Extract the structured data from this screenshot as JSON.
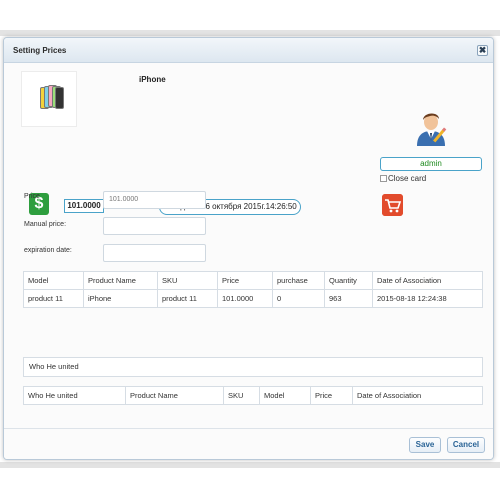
{
  "dialog": {
    "title": "Setting Prices",
    "close_glyph": "✖"
  },
  "product": {
    "name": "iPhone",
    "image_icon": "iphone-product-image"
  },
  "user": {
    "name": "admin",
    "close_card_label": "Close card",
    "close_card_checked": false
  },
  "price_display": "101.0000",
  "date_text": "Сегодня - 06 октября 2015г.14:26:50",
  "form": {
    "price_label": "Price",
    "price_value": "101.0000",
    "manual_price_label": "Manual price:",
    "manual_price_value": "",
    "expiration_label": "expiration date:",
    "expiration_value": ""
  },
  "table1": {
    "headers": [
      "Model",
      "Product Name",
      "SKU",
      "Price",
      "purchase",
      "Quantity",
      "Date of Association"
    ],
    "rows": [
      [
        "product 11",
        "iPhone",
        "product 11",
        "101.0000",
        "0",
        "963",
        "2015-08-18 12:24:38"
      ]
    ]
  },
  "united_panel": {
    "label": "Who He united"
  },
  "table2": {
    "headers": [
      "Who He united",
      "Product Name",
      "SKU",
      "Model",
      "Price",
      "Date of Association"
    ]
  },
  "footer": {
    "save_label": "Save",
    "cancel_label": "Cancel"
  },
  "colors": {
    "accent": "#4aa3c9",
    "dollar_icon": "#2e9e3e",
    "cart_icon": "#e24b2c",
    "quantity_text": "#2aa02a",
    "button_text": "#2a6496"
  }
}
